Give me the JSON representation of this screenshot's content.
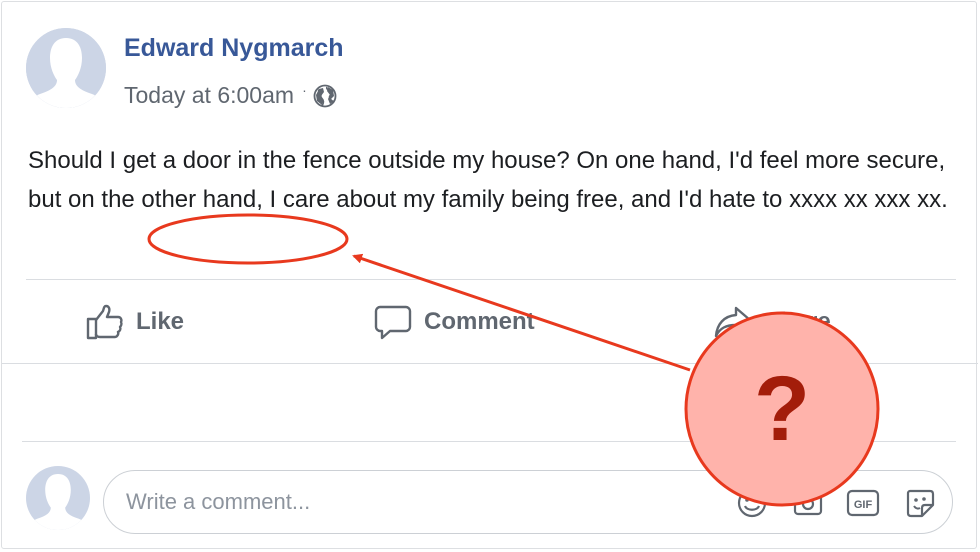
{
  "post": {
    "author": "Edward Nygmarch",
    "timestamp": "Today at 6:00am",
    "separator": "·",
    "privacy_icon": "globe-icon",
    "text_before": "Should I get a door in the fence outside my house? On one hand, I'd feel more secure, but on the other hand, I care about my family being free, and I'd hate to ",
    "text_redacted": "xxxx xx xxx xx",
    "text_after": "."
  },
  "actions": {
    "like_label": "Like",
    "comment_label": "Comment",
    "share_label": "Share"
  },
  "comment_input": {
    "placeholder": "Write a comment...",
    "icons": [
      "emoji-icon",
      "camera-icon",
      "gif-icon",
      "sticker-icon"
    ],
    "gif_text": "GIF"
  },
  "annotation": {
    "symbol": "?",
    "color": "#e8391e",
    "fill": "#ffb3ab"
  }
}
